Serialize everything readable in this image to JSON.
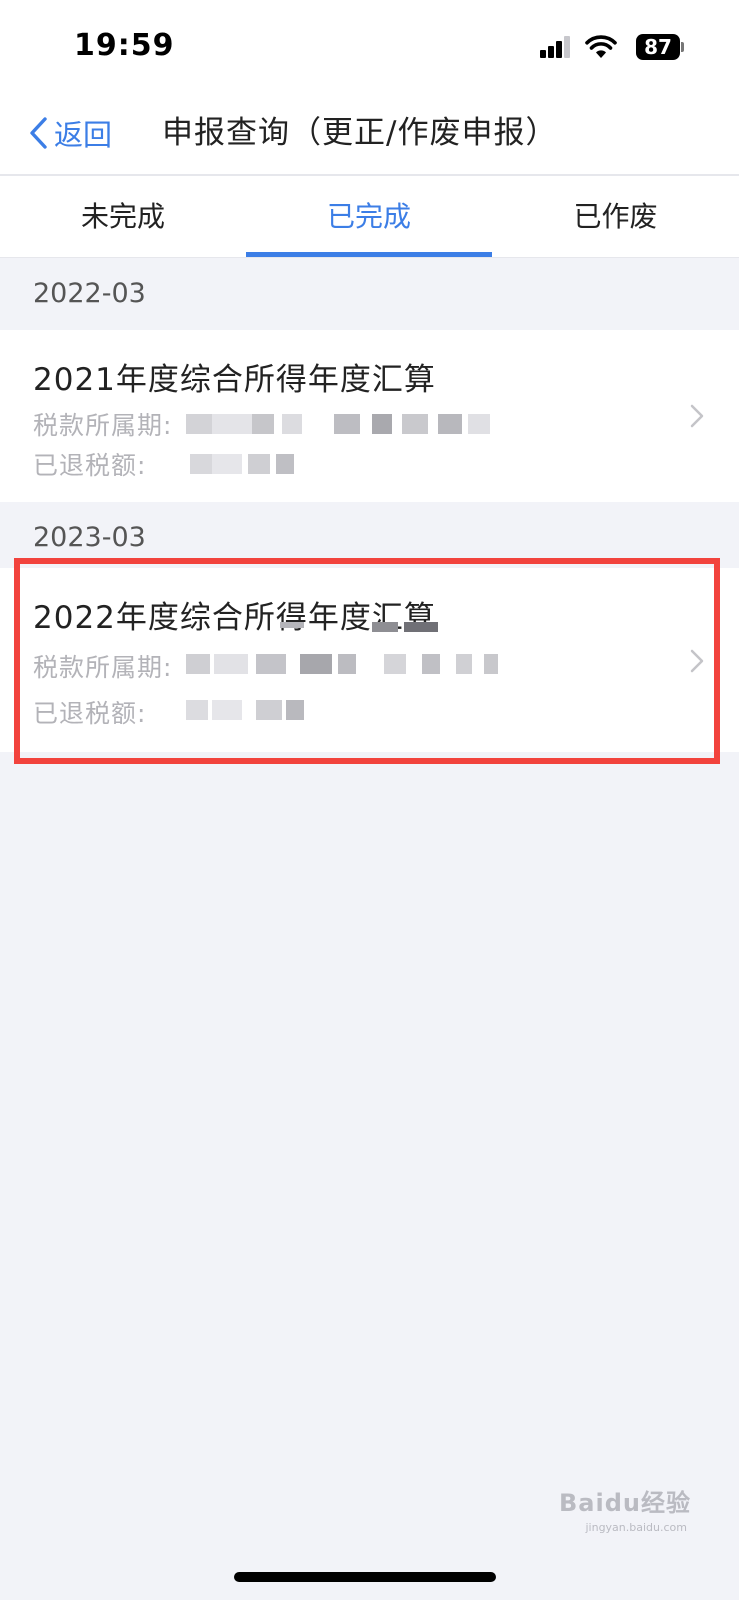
{
  "status_bar": {
    "time": "19:59",
    "battery": "87"
  },
  "nav": {
    "back_label": "返回",
    "title": "申报查询（更正/作废申报）"
  },
  "tabs": [
    {
      "label": "未完成",
      "active": false
    },
    {
      "label": "已完成",
      "active": true
    },
    {
      "label": "已作废",
      "active": false
    }
  ],
  "groups": [
    {
      "date": "2022-03",
      "item": {
        "title": "2021年度综合所得年度汇算",
        "period_label": "税款所属期:",
        "refund_label": "已退税额:"
      }
    },
    {
      "date": "2023-03",
      "item": {
        "title": "2022年度综合所得年度汇算",
        "period_label": "税款所属期:",
        "refund_label": "已退税额:"
      }
    }
  ],
  "watermark": {
    "brand": "Baidu经验",
    "sub": "jingyan.baidu.com"
  },
  "colors": {
    "accent": "#3c7ee6",
    "highlight": "#f2433d",
    "background": "#f2f3f8"
  }
}
